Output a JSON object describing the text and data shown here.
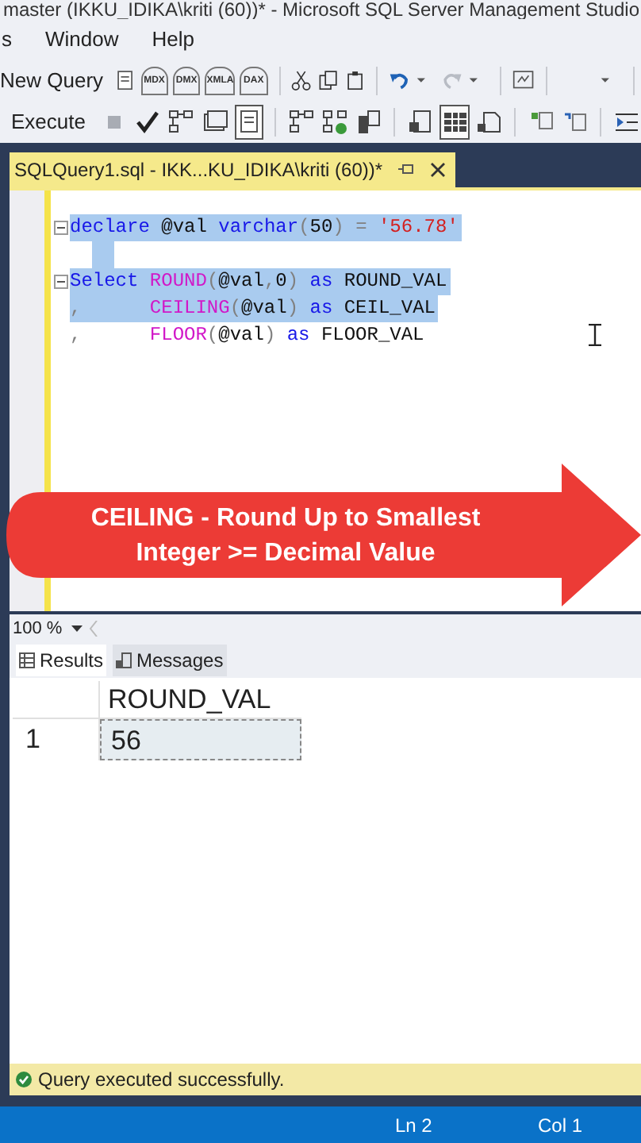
{
  "window": {
    "title": "master (IKKU_IDIKA\\kriti (60))* - Microsoft SQL Server Management Studio"
  },
  "menu": [
    "s",
    "Window",
    "Help"
  ],
  "toolbar_1": {
    "new_query": "New Query",
    "query_types": [
      "MDX",
      "DMX",
      "XMLA",
      "DAX"
    ]
  },
  "toolbar_2": {
    "execute": "Execute",
    "buttons": [
      {
        "pressed": false
      },
      {
        "pressed": false
      },
      {
        "pressed": false
      },
      {
        "pressed": false
      },
      {
        "pressed": true
      },
      {
        "pressed": false
      },
      {
        "pressed": false
      },
      {
        "pressed": false
      },
      {
        "pressed": false
      },
      {
        "pressed": true
      },
      {
        "pressed": false
      },
      {
        "pressed": false
      },
      {
        "pressed": false
      },
      {
        "pressed": false
      }
    ]
  },
  "document_tab": {
    "title": "SQLQuery1.sql - IKK...KU_IDIKA\\kriti (60))*",
    "selected": true
  },
  "editor": {
    "lines": [
      {
        "collapsible": true,
        "selected": true,
        "tokens": [
          {
            "kind": "keyword",
            "text": "declare"
          },
          {
            "kind": "plain",
            "text": " @val "
          },
          {
            "kind": "keyword",
            "text": "varchar"
          },
          {
            "kind": "operator",
            "text": "("
          },
          {
            "kind": "plain",
            "text": "50"
          },
          {
            "kind": "operator",
            "text": ") = "
          },
          {
            "kind": "string",
            "text": "'56.78'"
          }
        ]
      },
      {
        "collapsible": false,
        "selected": true
      },
      {
        "collapsible": true,
        "selected": true,
        "tokens": [
          {
            "kind": "keyword",
            "text": "Select"
          },
          {
            "kind": "function",
            "text": " ROUND"
          },
          {
            "kind": "operator",
            "text": "("
          },
          {
            "kind": "plain",
            "text": "@val"
          },
          {
            "kind": "operator",
            "text": ","
          },
          {
            "kind": "plain",
            "text": "0"
          },
          {
            "kind": "operator",
            "text": ") "
          },
          {
            "kind": "keyword",
            "text": "as"
          },
          {
            "kind": "plain",
            "text": " ROUND_VAL"
          }
        ]
      },
      {
        "collapsible": false,
        "selected": true,
        "tokens": [
          {
            "kind": "operator",
            "text": ","
          },
          {
            "kind": "function",
            "text": "      CEILING"
          },
          {
            "kind": "operator",
            "text": "("
          },
          {
            "kind": "plain",
            "text": "@val"
          },
          {
            "kind": "operator",
            "text": ") "
          },
          {
            "kind": "keyword",
            "text": "as"
          },
          {
            "kind": "plain",
            "text": " CEIL_VAL"
          }
        ]
      },
      {
        "collapsible": false,
        "selected": false,
        "tokens": [
          {
            "kind": "operator",
            "text": ","
          },
          {
            "kind": "function",
            "text": "      FLOOR"
          },
          {
            "kind": "operator",
            "text": "("
          },
          {
            "kind": "plain",
            "text": "@val"
          },
          {
            "kind": "operator",
            "text": ") "
          },
          {
            "kind": "keyword",
            "text": "as"
          },
          {
            "kind": "plain",
            "text": " FLOOR_VAL"
          }
        ]
      }
    ]
  },
  "annotation": {
    "lines": [
      "CEILING - Round Up to Smallest",
      "Integer >= Decimal Value"
    ]
  },
  "zoom": "100 %",
  "result_tabs": [
    {
      "label": "Results",
      "selected": true
    },
    {
      "label": "Messages",
      "selected": false
    }
  ],
  "results": {
    "columns": [
      "ROUND_VAL"
    ],
    "rows": [
      {
        "number": "1",
        "cells": [
          "56"
        ],
        "selected": true
      }
    ]
  },
  "query_status": "Query executed successfully.",
  "status_bar": {
    "line": "Ln 2",
    "column": "Col 1"
  }
}
